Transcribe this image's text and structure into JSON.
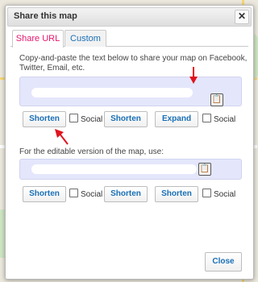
{
  "dialog": {
    "title": "Share this map",
    "close_glyph": "✕"
  },
  "tabs": [
    {
      "label": "Share URL",
      "active": true
    },
    {
      "label": "Custom",
      "active": false
    }
  ],
  "share": {
    "description": "Copy-and-paste the text below to share your map on Facebook, Twitter, Email, etc.",
    "url_value": "",
    "buttons": {
      "shorten1": "Shorten",
      "social1": "Social",
      "shorten2": "Shorten",
      "expand": "Expand",
      "social2": "Social"
    }
  },
  "edit": {
    "description": "For the editable version of the map, use:",
    "url_value": "",
    "buttons": {
      "shorten1": "Shorten",
      "social1": "Social",
      "shorten2": "Shorten",
      "shorten3": "Shorten",
      "social2": "Social"
    }
  },
  "footer": {
    "close_label": "Close"
  },
  "icons": {
    "copy": "clipboard-icon",
    "annotation_arrows": "red-arrow"
  },
  "colors": {
    "accent_tab": "#e5176c",
    "link_blue": "#1a6fb5",
    "url_bg": "#e4e6fb",
    "arrow_red": "#e0141e"
  }
}
